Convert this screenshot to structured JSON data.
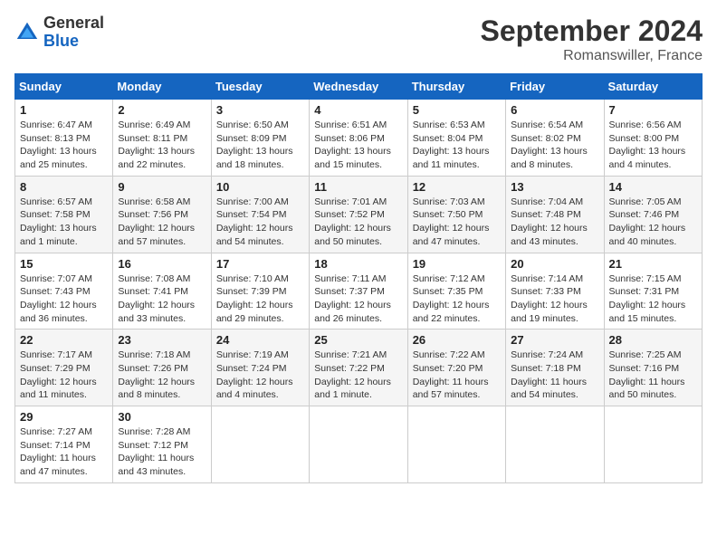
{
  "header": {
    "logo_general": "General",
    "logo_blue": "Blue",
    "month_title": "September 2024",
    "location": "Romanswiller, France"
  },
  "weekdays": [
    "Sunday",
    "Monday",
    "Tuesday",
    "Wednesday",
    "Thursday",
    "Friday",
    "Saturday"
  ],
  "weeks": [
    [
      {
        "day": "1",
        "sunrise": "Sunrise: 6:47 AM",
        "sunset": "Sunset: 8:13 PM",
        "daylight": "Daylight: 13 hours and 25 minutes."
      },
      {
        "day": "2",
        "sunrise": "Sunrise: 6:49 AM",
        "sunset": "Sunset: 8:11 PM",
        "daylight": "Daylight: 13 hours and 22 minutes."
      },
      {
        "day": "3",
        "sunrise": "Sunrise: 6:50 AM",
        "sunset": "Sunset: 8:09 PM",
        "daylight": "Daylight: 13 hours and 18 minutes."
      },
      {
        "day": "4",
        "sunrise": "Sunrise: 6:51 AM",
        "sunset": "Sunset: 8:06 PM",
        "daylight": "Daylight: 13 hours and 15 minutes."
      },
      {
        "day": "5",
        "sunrise": "Sunrise: 6:53 AM",
        "sunset": "Sunset: 8:04 PM",
        "daylight": "Daylight: 13 hours and 11 minutes."
      },
      {
        "day": "6",
        "sunrise": "Sunrise: 6:54 AM",
        "sunset": "Sunset: 8:02 PM",
        "daylight": "Daylight: 13 hours and 8 minutes."
      },
      {
        "day": "7",
        "sunrise": "Sunrise: 6:56 AM",
        "sunset": "Sunset: 8:00 PM",
        "daylight": "Daylight: 13 hours and 4 minutes."
      }
    ],
    [
      {
        "day": "8",
        "sunrise": "Sunrise: 6:57 AM",
        "sunset": "Sunset: 7:58 PM",
        "daylight": "Daylight: 13 hours and 1 minute."
      },
      {
        "day": "9",
        "sunrise": "Sunrise: 6:58 AM",
        "sunset": "Sunset: 7:56 PM",
        "daylight": "Daylight: 12 hours and 57 minutes."
      },
      {
        "day": "10",
        "sunrise": "Sunrise: 7:00 AM",
        "sunset": "Sunset: 7:54 PM",
        "daylight": "Daylight: 12 hours and 54 minutes."
      },
      {
        "day": "11",
        "sunrise": "Sunrise: 7:01 AM",
        "sunset": "Sunset: 7:52 PM",
        "daylight": "Daylight: 12 hours and 50 minutes."
      },
      {
        "day": "12",
        "sunrise": "Sunrise: 7:03 AM",
        "sunset": "Sunset: 7:50 PM",
        "daylight": "Daylight: 12 hours and 47 minutes."
      },
      {
        "day": "13",
        "sunrise": "Sunrise: 7:04 AM",
        "sunset": "Sunset: 7:48 PM",
        "daylight": "Daylight: 12 hours and 43 minutes."
      },
      {
        "day": "14",
        "sunrise": "Sunrise: 7:05 AM",
        "sunset": "Sunset: 7:46 PM",
        "daylight": "Daylight: 12 hours and 40 minutes."
      }
    ],
    [
      {
        "day": "15",
        "sunrise": "Sunrise: 7:07 AM",
        "sunset": "Sunset: 7:43 PM",
        "daylight": "Daylight: 12 hours and 36 minutes."
      },
      {
        "day": "16",
        "sunrise": "Sunrise: 7:08 AM",
        "sunset": "Sunset: 7:41 PM",
        "daylight": "Daylight: 12 hours and 33 minutes."
      },
      {
        "day": "17",
        "sunrise": "Sunrise: 7:10 AM",
        "sunset": "Sunset: 7:39 PM",
        "daylight": "Daylight: 12 hours and 29 minutes."
      },
      {
        "day": "18",
        "sunrise": "Sunrise: 7:11 AM",
        "sunset": "Sunset: 7:37 PM",
        "daylight": "Daylight: 12 hours and 26 minutes."
      },
      {
        "day": "19",
        "sunrise": "Sunrise: 7:12 AM",
        "sunset": "Sunset: 7:35 PM",
        "daylight": "Daylight: 12 hours and 22 minutes."
      },
      {
        "day": "20",
        "sunrise": "Sunrise: 7:14 AM",
        "sunset": "Sunset: 7:33 PM",
        "daylight": "Daylight: 12 hours and 19 minutes."
      },
      {
        "day": "21",
        "sunrise": "Sunrise: 7:15 AM",
        "sunset": "Sunset: 7:31 PM",
        "daylight": "Daylight: 12 hours and 15 minutes."
      }
    ],
    [
      {
        "day": "22",
        "sunrise": "Sunrise: 7:17 AM",
        "sunset": "Sunset: 7:29 PM",
        "daylight": "Daylight: 12 hours and 11 minutes."
      },
      {
        "day": "23",
        "sunrise": "Sunrise: 7:18 AM",
        "sunset": "Sunset: 7:26 PM",
        "daylight": "Daylight: 12 hours and 8 minutes."
      },
      {
        "day": "24",
        "sunrise": "Sunrise: 7:19 AM",
        "sunset": "Sunset: 7:24 PM",
        "daylight": "Daylight: 12 hours and 4 minutes."
      },
      {
        "day": "25",
        "sunrise": "Sunrise: 7:21 AM",
        "sunset": "Sunset: 7:22 PM",
        "daylight": "Daylight: 12 hours and 1 minute."
      },
      {
        "day": "26",
        "sunrise": "Sunrise: 7:22 AM",
        "sunset": "Sunset: 7:20 PM",
        "daylight": "Daylight: 11 hours and 57 minutes."
      },
      {
        "day": "27",
        "sunrise": "Sunrise: 7:24 AM",
        "sunset": "Sunset: 7:18 PM",
        "daylight": "Daylight: 11 hours and 54 minutes."
      },
      {
        "day": "28",
        "sunrise": "Sunrise: 7:25 AM",
        "sunset": "Sunset: 7:16 PM",
        "daylight": "Daylight: 11 hours and 50 minutes."
      }
    ],
    [
      {
        "day": "29",
        "sunrise": "Sunrise: 7:27 AM",
        "sunset": "Sunset: 7:14 PM",
        "daylight": "Daylight: 11 hours and 47 minutes."
      },
      {
        "day": "30",
        "sunrise": "Sunrise: 7:28 AM",
        "sunset": "Sunset: 7:12 PM",
        "daylight": "Daylight: 11 hours and 43 minutes."
      },
      null,
      null,
      null,
      null,
      null
    ]
  ]
}
